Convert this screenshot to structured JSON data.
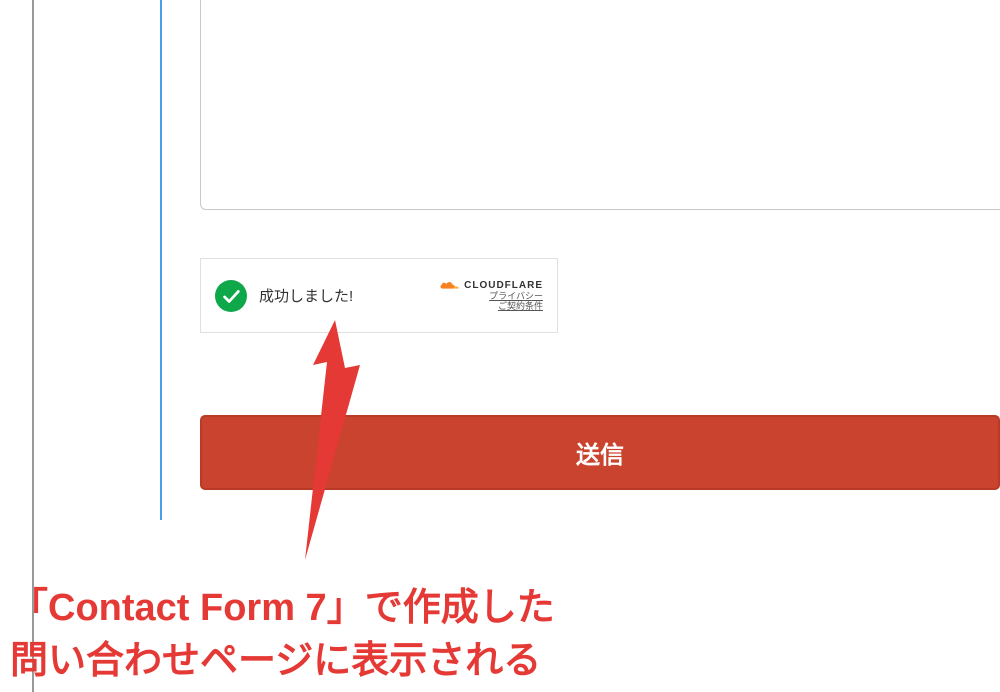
{
  "turnstile": {
    "success_text": "成功しました!",
    "brand_name": "CLOUDFLARE",
    "privacy_link": "プライバシー",
    "terms_link": "ご契約条件"
  },
  "form": {
    "submit_label": "送信"
  },
  "annotation": {
    "line1": "「Contact Form 7」で作成した",
    "line2": "問い合わせページに表示される"
  }
}
